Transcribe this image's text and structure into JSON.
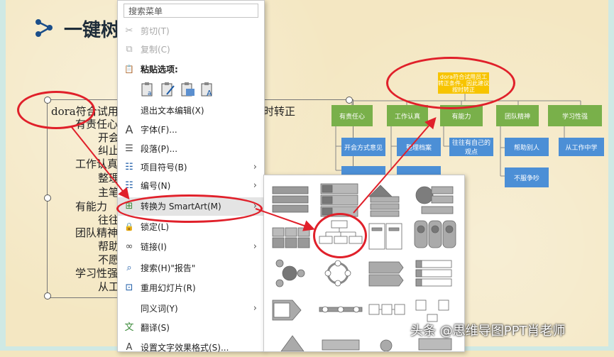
{
  "slide": {
    "title": "一键树",
    "outline": [
      {
        "text": "dora符合试用员工转正条件，因此建议按时转正",
        "indent": 0
      },
      {
        "text": "有责任心",
        "indent": 1
      },
      {
        "text": "开会",
        "indent": 2
      },
      {
        "text": "纠止",
        "indent": 2
      },
      {
        "text": "工作认真",
        "indent": 1
      },
      {
        "text": "整理",
        "indent": 2
      },
      {
        "text": "主笔",
        "indent": 2
      },
      {
        "text": "有能力",
        "indent": 1
      },
      {
        "text": "往往",
        "indent": 2
      },
      {
        "text": "团队精神",
        "indent": 1
      },
      {
        "text": "帮助",
        "indent": 2
      },
      {
        "text": "不愿",
        "indent": 2
      },
      {
        "text": "学习性强",
        "indent": 1
      },
      {
        "text": "从工",
        "indent": 2
      }
    ],
    "outline_visible": [
      "dora符合试用",
      "有责任心",
      "开会",
      "纠止",
      "工作认真",
      "整理",
      "主笔",
      "有能力",
      "往往",
      "团队精神",
      "帮助",
      "不愿",
      "学习性强",
      "从工"
    ],
    "outline_tail": "时转正"
  },
  "context_menu": {
    "search_placeholder": "搜索菜单",
    "items": [
      {
        "label": "剪切(T)",
        "icon": "scissors-icon",
        "glyph": "✂",
        "disabled": true
      },
      {
        "label": "复制(C)",
        "icon": "copy-icon",
        "glyph": "⧉",
        "disabled": true
      },
      {
        "label": "粘贴选项:",
        "icon": "paste-icon",
        "glyph": "📋",
        "bold": true
      },
      {
        "label": "退出文本编辑(X)",
        "icon": "",
        "glyph": ""
      },
      {
        "label": "字体(F)...",
        "icon": "font-icon",
        "glyph": "A"
      },
      {
        "label": "段落(P)...",
        "icon": "paragraph-icon",
        "glyph": "☰"
      },
      {
        "label": "项目符号(B)",
        "icon": "bullets-icon",
        "glyph": "☷",
        "submenu": true
      },
      {
        "label": "编号(N)",
        "icon": "numbering-icon",
        "glyph": "☷",
        "submenu": true
      },
      {
        "label": "转换为 SmartArt(M)",
        "icon": "smartart-icon",
        "glyph": "⊞",
        "submenu": true,
        "highlighted": true
      },
      {
        "label": "锁定(L)",
        "icon": "lock-icon",
        "glyph": "🔒"
      },
      {
        "label": "链接(I)",
        "icon": "link-icon",
        "glyph": "∞",
        "submenu": true
      },
      {
        "label": "搜索(H)\"报告\"",
        "icon": "search-icon",
        "glyph": "⌕"
      },
      {
        "label": "重用幻灯片(R)",
        "icon": "reuse-slides-icon",
        "glyph": "⊡"
      },
      {
        "label": "同义词(Y)",
        "icon": "",
        "glyph": "",
        "submenu": true
      },
      {
        "label": "翻译(S)",
        "icon": "translate-icon",
        "glyph": "文"
      },
      {
        "label": "设置文字效果格式(S)...",
        "icon": "text-effects-icon",
        "glyph": "A"
      }
    ],
    "submenu_arrow": "›"
  },
  "smartart_gallery": {
    "rows": 5,
    "cols": 4
  },
  "org_chart": {
    "root": "dora符合试用员工转正条件，因此建议按时转正",
    "branches": [
      {
        "label": "有责任心",
        "children": [
          "开会方式意见",
          ""
        ]
      },
      {
        "label": "工作认真",
        "children": [
          "整理档案",
          ""
        ]
      },
      {
        "label": "有能力",
        "children": [
          "往往有自己的观点"
        ]
      },
      {
        "label": "团队精神",
        "children": [
          "帮助别人",
          "不服争吵"
        ]
      },
      {
        "label": "学习性强",
        "children": [
          "从工作中学"
        ]
      }
    ]
  },
  "watermark": "头条 @思维导图PPT肖老师",
  "colors": {
    "highlight_circle": "#e0202a",
    "node_green": "#79b04a",
    "node_blue": "#4c8fd6",
    "root_yellow": "#f7c400"
  }
}
